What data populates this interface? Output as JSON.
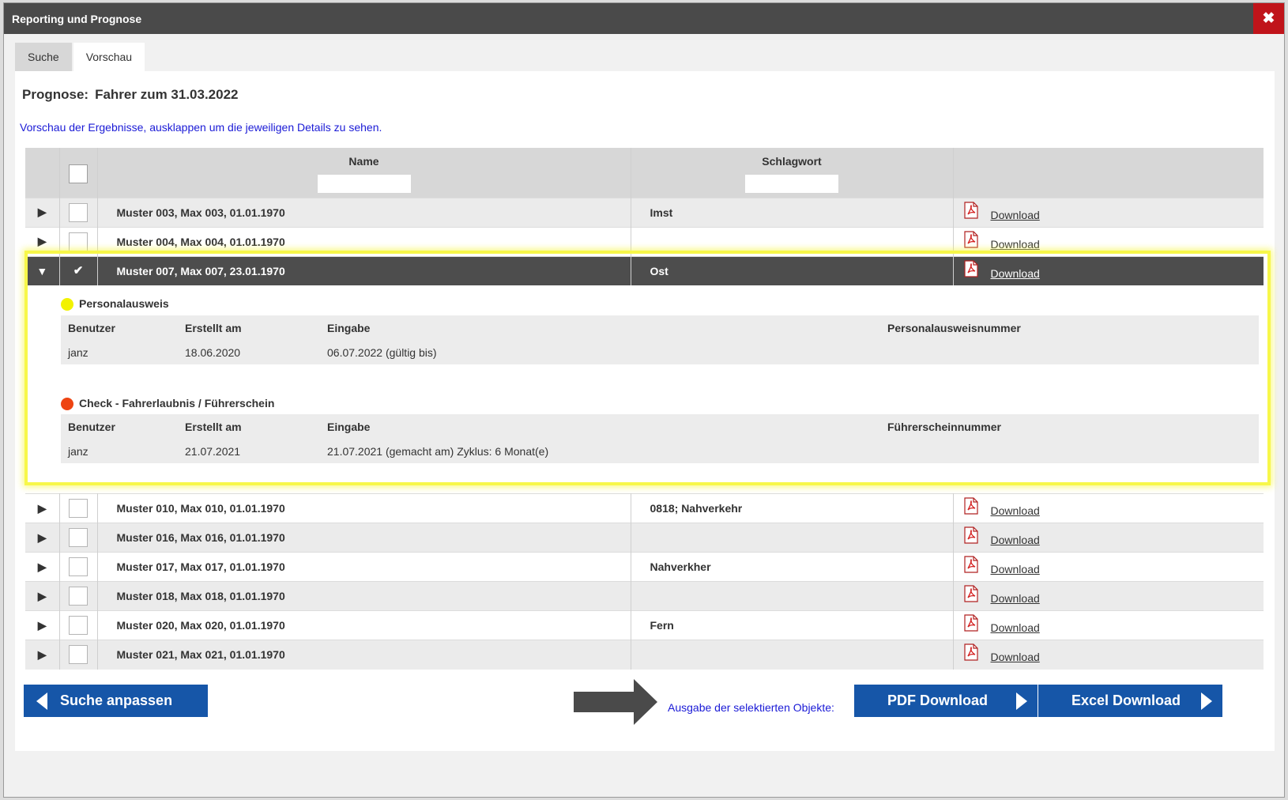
{
  "window": {
    "title": "Reporting und Prognose",
    "close_label": "✖"
  },
  "tabs": [
    {
      "label": "Suche"
    },
    {
      "label": "Vorschau"
    }
  ],
  "prognose": {
    "label": "Prognose:",
    "value": "Fahrer zum 31.03.2022"
  },
  "hint": "Vorschau der Ergebnisse, ausklappen um die jeweiligen Details zu sehen.",
  "columns": {
    "name": "Name",
    "schlagwort": "Schlagwort"
  },
  "download_label": "Download",
  "rows": [
    {
      "name": "Muster 003, Max 003, 01.01.1970",
      "schlagwort": "Imst"
    },
    {
      "name": "Muster 004, Max 004, 01.01.1970",
      "schlagwort": ""
    },
    {
      "name": "Muster 007, Max 007, 23.01.1970",
      "schlagwort": "Ost"
    },
    {
      "name": "Muster 010, Max 010, 01.01.1970",
      "schlagwort": "0818; Nahverkehr"
    },
    {
      "name": "Muster 016, Max 016, 01.01.1970",
      "schlagwort": ""
    },
    {
      "name": "Muster 017, Max 017, 01.01.1970",
      "schlagwort": "Nahverkher"
    },
    {
      "name": "Muster 018, Max 018, 01.01.1970",
      "schlagwort": ""
    },
    {
      "name": "Muster 020, Max 020, 01.01.1970",
      "schlagwort": "Fern"
    },
    {
      "name": "Muster 021, Max 021, 01.01.1970",
      "schlagwort": ""
    }
  ],
  "detail": {
    "sections": [
      {
        "title": "Personalausweis",
        "color": "#f2f200",
        "headers": [
          "Benutzer",
          "Erstellt am",
          "Eingabe",
          "Personalausweisnummer"
        ],
        "values": [
          "janz",
          "18.06.2020",
          "06.07.2022 (gültig bis)",
          ""
        ]
      },
      {
        "title": "Check - Fahrerlaubnis / Führerschein",
        "color": "#ee4412",
        "headers": [
          "Benutzer",
          "Erstellt am",
          "Eingabe",
          "Führerscheinnummer"
        ],
        "values": [
          "janz",
          "21.07.2021",
          "21.07.2021 (gemacht am) Zyklus: 6 Monat(e)",
          ""
        ]
      }
    ]
  },
  "buttons": {
    "suche": "Suche anpassen",
    "pdf": "PDF Download",
    "excel": "Excel Download"
  },
  "output_text": "Ausgabe der selektierten Objekte:",
  "colors": {
    "accent_blue": "#1656a8",
    "close_red": "#c0141a",
    "highlight": "#f7f74a"
  }
}
